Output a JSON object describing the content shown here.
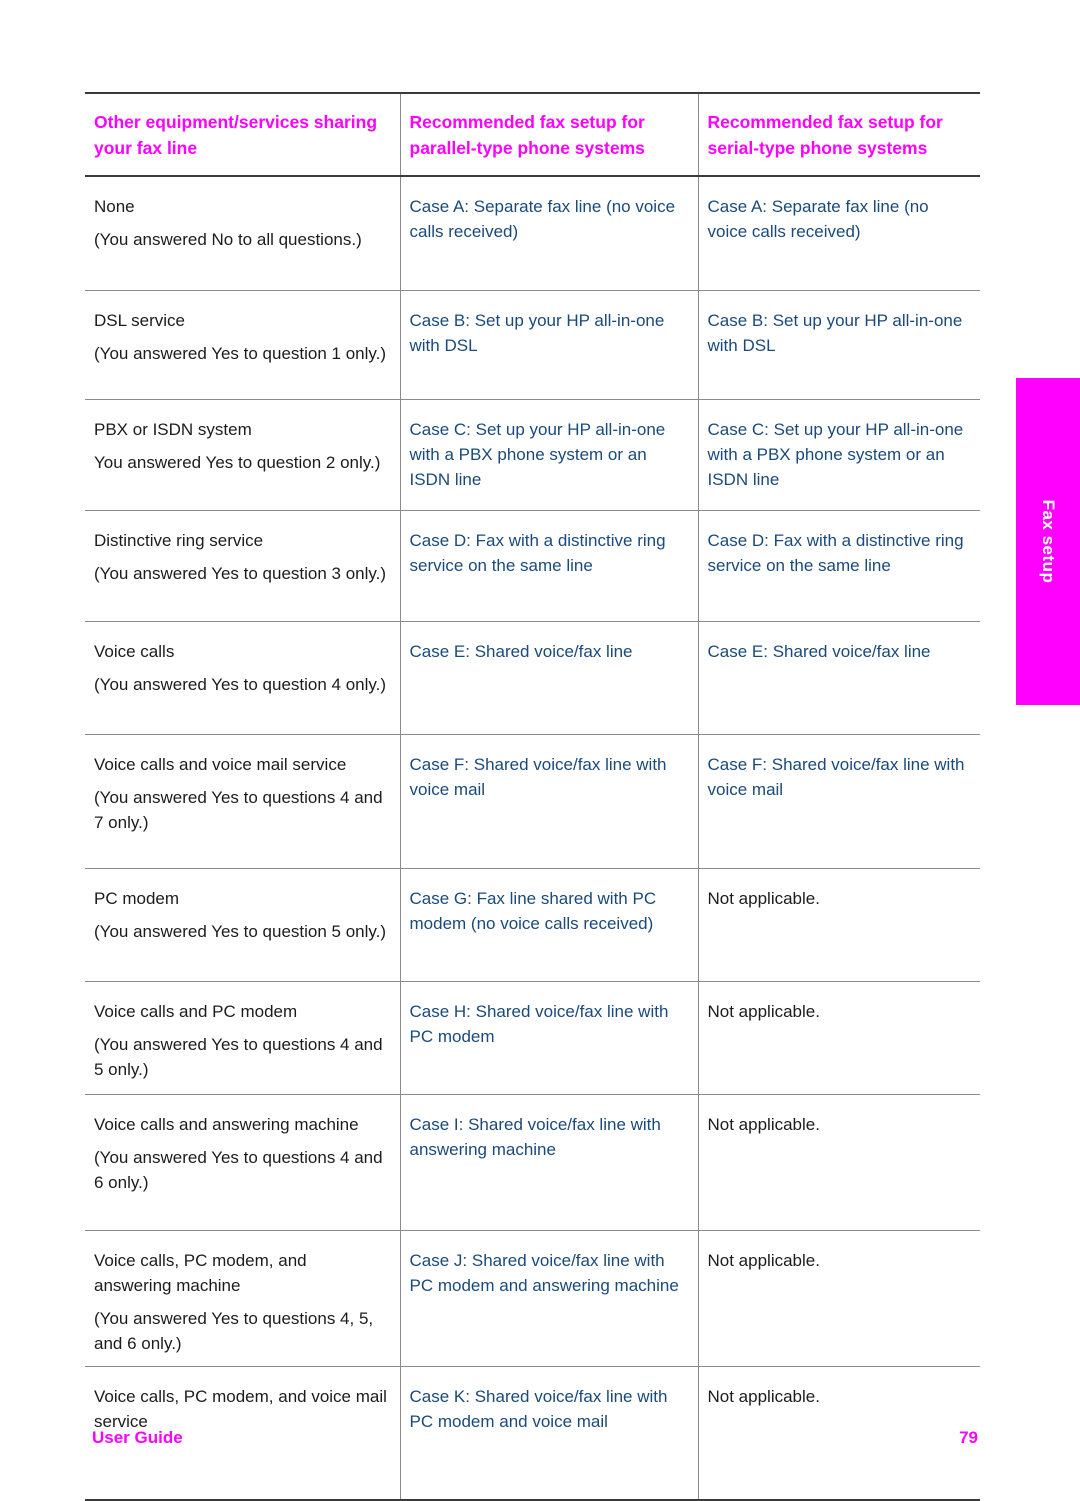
{
  "page": {
    "side_tab_label": "Fax setup",
    "accent_magenta": "#FF00FF",
    "link_blue": "#1A4A7A",
    "body_black": "#1C1C1C"
  },
  "table": {
    "headers": [
      "Other equipment/services sharing your fax line",
      "Recommended fax setup for parallel-type phone systems",
      "Recommended fax setup for serial-type phone systems"
    ],
    "rows": [
      {
        "key": "none",
        "equipment_title": "None",
        "equipment_note": "(You answered No to all questions.)",
        "parallel": "Case A: Separate fax line (no voice calls received)",
        "serial": "Case A: Separate fax line (no voice calls received)",
        "serial_is_na": false
      },
      {
        "key": "dsl",
        "equipment_title": "DSL service",
        "equipment_note": "(You answered Yes to question 1 only.)",
        "parallel": "Case B: Set up your HP all-in-one with DSL",
        "serial": "Case B: Set up your HP all-in-one with DSL",
        "serial_is_na": false
      },
      {
        "key": "pbx",
        "equipment_title": "PBX or ISDN system",
        "equipment_note": "You answered Yes to question 2 only.)",
        "parallel": "Case C: Set up your HP all-in-one with a PBX phone system or an ISDN line",
        "serial": "Case C: Set up your HP all-in-one with a PBX phone system or an ISDN line",
        "serial_is_na": false
      },
      {
        "key": "distinctive",
        "equipment_title": "Distinctive ring service",
        "equipment_note": "(You answered Yes to question 3 only.)",
        "parallel": "Case D: Fax with a distinctive ring service on the same line",
        "serial": "Case D: Fax with a distinctive ring service on the same line",
        "serial_is_na": false
      },
      {
        "key": "voice",
        "equipment_title": "Voice calls",
        "equipment_note": "(You answered Yes to question 4 only.)",
        "parallel": "Case E: Shared voice/fax line",
        "serial": "Case E: Shared voice/fax line",
        "serial_is_na": false
      },
      {
        "key": "voicemail",
        "equipment_title": "Voice calls and voice mail service",
        "equipment_note": "(You answered Yes to questions 4 and 7 only.)",
        "parallel": "Case F: Shared voice/fax line with voice mail",
        "serial": "Case F: Shared voice/fax line with voice mail",
        "serial_is_na": false
      },
      {
        "key": "pcmodem",
        "equipment_title": "PC modem",
        "equipment_note": "(You answered Yes to question 5 only.)",
        "parallel": "Case G: Fax line shared with PC modem (no voice calls received)",
        "serial": "Not applicable.",
        "serial_is_na": true
      },
      {
        "key": "voice-pc",
        "equipment_title": "Voice calls and PC modem",
        "equipment_note": "(You answered Yes to questions 4 and 5 only.)",
        "parallel": "Case H: Shared voice/fax line with PC modem",
        "serial": "Not applicable.",
        "serial_is_na": true
      },
      {
        "key": "voice-ans",
        "equipment_title": "Voice calls and answering machine",
        "equipment_note": "(You answered Yes to questions 4 and 6 only.)",
        "parallel": "Case I: Shared voice/fax line with answering machine",
        "serial": "Not applicable.",
        "serial_is_na": true
      },
      {
        "key": "voice-pc-ans",
        "equipment_title": "Voice calls, PC modem, and answering machine",
        "equipment_note": "(You answered Yes to questions 4, 5, and 6 only.)",
        "parallel": "Case J: Shared voice/fax line with PC modem and answering machine",
        "serial": "Not applicable.",
        "serial_is_na": true
      },
      {
        "key": "voice-pc-vm",
        "equipment_title": "Voice calls, PC modem, and voice mail service",
        "equipment_note": "",
        "parallel": "Case K: Shared voice/fax line with PC modem and voice mail",
        "serial": "Not applicable.",
        "serial_is_na": true
      }
    ]
  },
  "footer": {
    "left_label": "User Guide",
    "page_number": "79"
  }
}
